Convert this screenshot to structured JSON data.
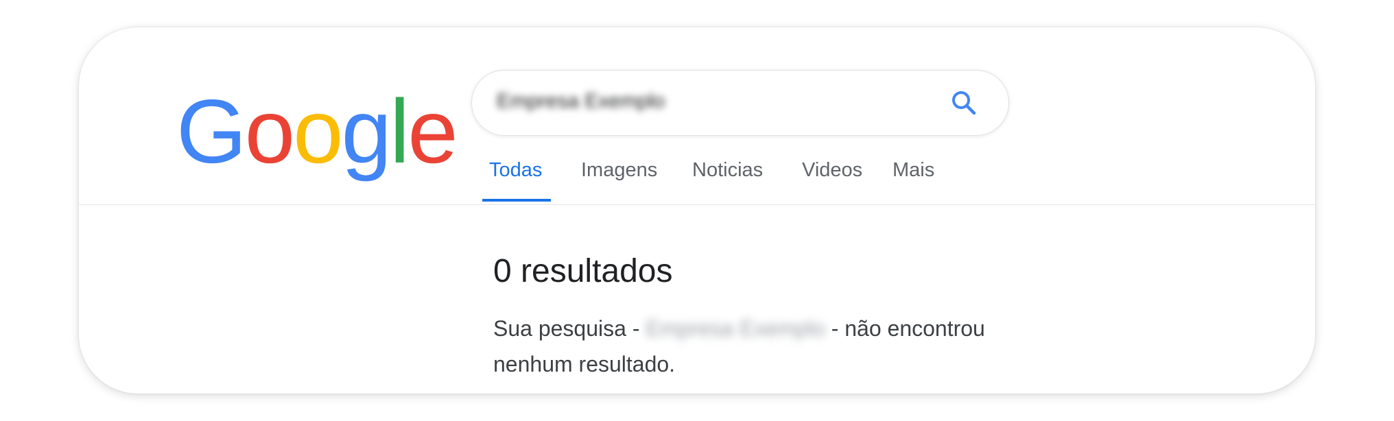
{
  "colors": {
    "blue": "#4285F4",
    "red": "#EA4335",
    "yellow": "#FBBC05",
    "green": "#34A853",
    "tab_active": "#1a73e8",
    "tab_inactive": "#5f6368"
  },
  "logo": {
    "letters": [
      "G",
      "o",
      "o",
      "g",
      "l",
      "e"
    ]
  },
  "search": {
    "query": "Empresa Exemplo",
    "icon": "search-icon"
  },
  "tabs": [
    {
      "label": "Todas",
      "active": true
    },
    {
      "label": "Imagens",
      "active": false
    },
    {
      "label": "Noticias",
      "active": false
    },
    {
      "label": "Videos",
      "active": false
    },
    {
      "label": "Mais",
      "active": false
    }
  ],
  "results": {
    "count_label": "0 resultados",
    "message_prefix": "Sua pesquisa -",
    "message_query": "Empresa Exemplo",
    "message_suffix": "- não encontrou nenhum resultado."
  }
}
